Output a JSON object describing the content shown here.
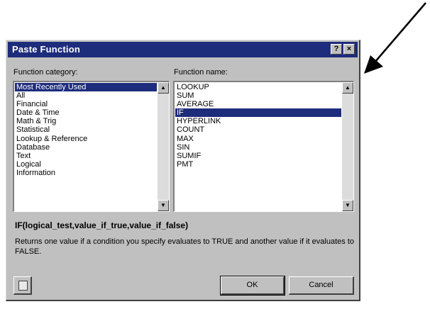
{
  "dialog": {
    "title": "Paste Function",
    "help_button": "?",
    "close_button": "×"
  },
  "category": {
    "label": "Function category:",
    "items": [
      "Most Recently Used",
      "All",
      "Financial",
      "Date & Time",
      "Math & Trig",
      "Statistical",
      "Lookup & Reference",
      "Database",
      "Text",
      "Logical",
      "Information"
    ],
    "selected": "Most Recently Used"
  },
  "function": {
    "label": "Function name:",
    "items": [
      "LOOKUP",
      "SUM",
      "AVERAGE",
      "IF",
      "HYPERLINK",
      "COUNT",
      "MAX",
      "SIN",
      "SUMIF",
      "PMT"
    ],
    "selected": "IF"
  },
  "syntax": "IF(logical_test,value_if_true,value_if_false)",
  "description": "Returns one value if a condition you specify evaluates to TRUE and another value if it evaluates to FALSE.",
  "buttons": {
    "ok": "OK",
    "cancel": "Cancel"
  },
  "icons": {
    "arrow": "annotation-arrow",
    "help": "office-assistant-icon"
  },
  "colors": {
    "titlebar": "#1e2c7c",
    "selection": "#1e2c7c",
    "face": "#c0c0c0"
  }
}
